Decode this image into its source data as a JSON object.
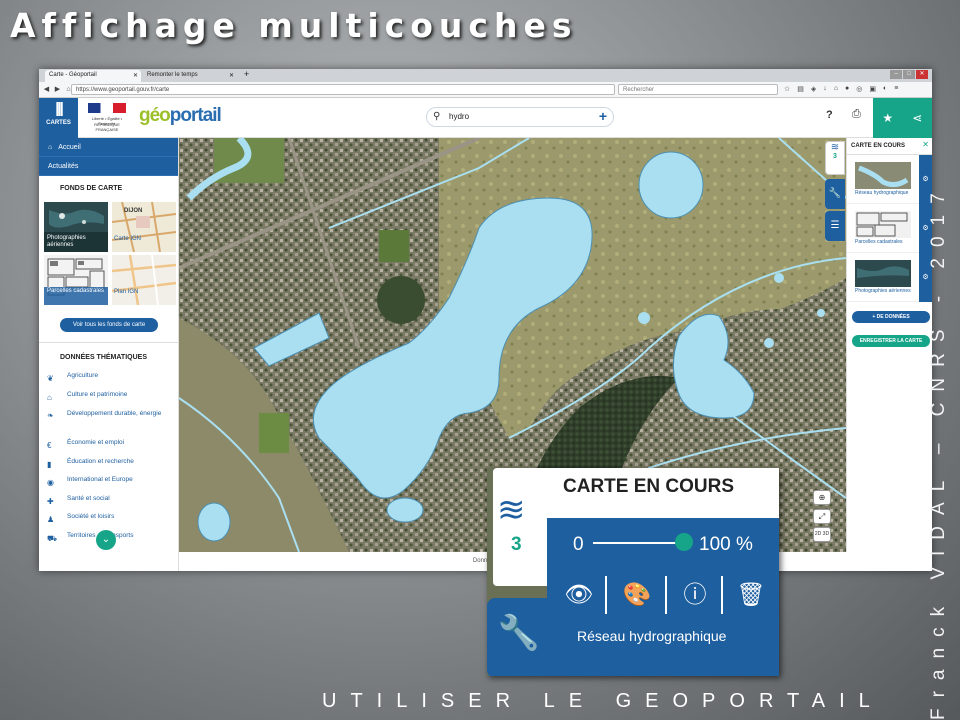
{
  "slide": {
    "title": "Affichage multicouches",
    "footer": "UTILISER LE GEOPORTAIL",
    "author": "Franck VIDAL – CNRS - 2017"
  },
  "browser": {
    "tabs": [
      {
        "label": "Carte - Géoportail"
      },
      {
        "label": "Remonter le temps"
      }
    ],
    "url": "https://www.geoportail.gouv.fr/carte",
    "search_placeholder": "Rechercher"
  },
  "header": {
    "cartes_label": "CARTES",
    "republique": "Liberté • Égalité • Fraternité",
    "republique_name": "RÉPUBLIQUE FRANÇAISE",
    "logo_a": "géo",
    "logo_b": "portail",
    "search_value": "hydro",
    "help": "?"
  },
  "sidebar": {
    "nav": [
      {
        "label": "Accueil"
      },
      {
        "label": "Actualités"
      }
    ],
    "basemaps_title": "FONDS DE CARTE",
    "basemaps": [
      {
        "label": "Photographies aériennes"
      },
      {
        "label": "Carte IGN"
      },
      {
        "label": "Parcelles cadastrales"
      },
      {
        "label": "Plan IGN"
      }
    ],
    "basemap_place": "DIJON",
    "all_basemaps": "Voir tous les fonds de carte",
    "thematic_title": "DONNÉES THÉMATIQUES",
    "thematics": [
      {
        "label": "Agriculture",
        "icon": "wheat-icon"
      },
      {
        "label": "Culture et patrimoine",
        "icon": "museum-icon"
      },
      {
        "label": "Développement durable, énergie",
        "icon": "leaf-icon"
      },
      {
        "label": "Économie et emploi",
        "icon": "euro-icon"
      },
      {
        "label": "Éducation et recherche",
        "icon": "book-icon"
      },
      {
        "label": "International et Europe",
        "icon": "globe-icon"
      },
      {
        "label": "Santé et social",
        "icon": "health-icon"
      },
      {
        "label": "Société et loisirs",
        "icon": "people-icon"
      },
      {
        "label": "Territoires et transports",
        "icon": "road-icon"
      }
    ]
  },
  "map": {
    "attribution": "Données cartographiques : © IGN, FEDER, Région Grand Est",
    "controls": [
      "locate-icon",
      "fullscreen-icon",
      "2d-3d-toggle"
    ]
  },
  "right_panel": {
    "title": "CARTE EN COURS",
    "layer_count": "3",
    "layers": [
      {
        "label": "Réseau hydrographique"
      },
      {
        "label": "Parcelles cadastrales"
      },
      {
        "label": "Photographies aériennes"
      }
    ],
    "add_data": "+ DE DONNÉES",
    "save_map": "ENREGISTRER LA CARTE"
  },
  "zoom": {
    "title": "CARTE EN COURS",
    "count": "3",
    "opacity_min": "0",
    "opacity_value": "100 %",
    "opacity_fraction": 1.0,
    "layer_name": "Réseau hydrographique"
  },
  "colors": {
    "primary_blue": "#1e5fa0",
    "teal": "#17a589",
    "water": "#a9dff0"
  }
}
